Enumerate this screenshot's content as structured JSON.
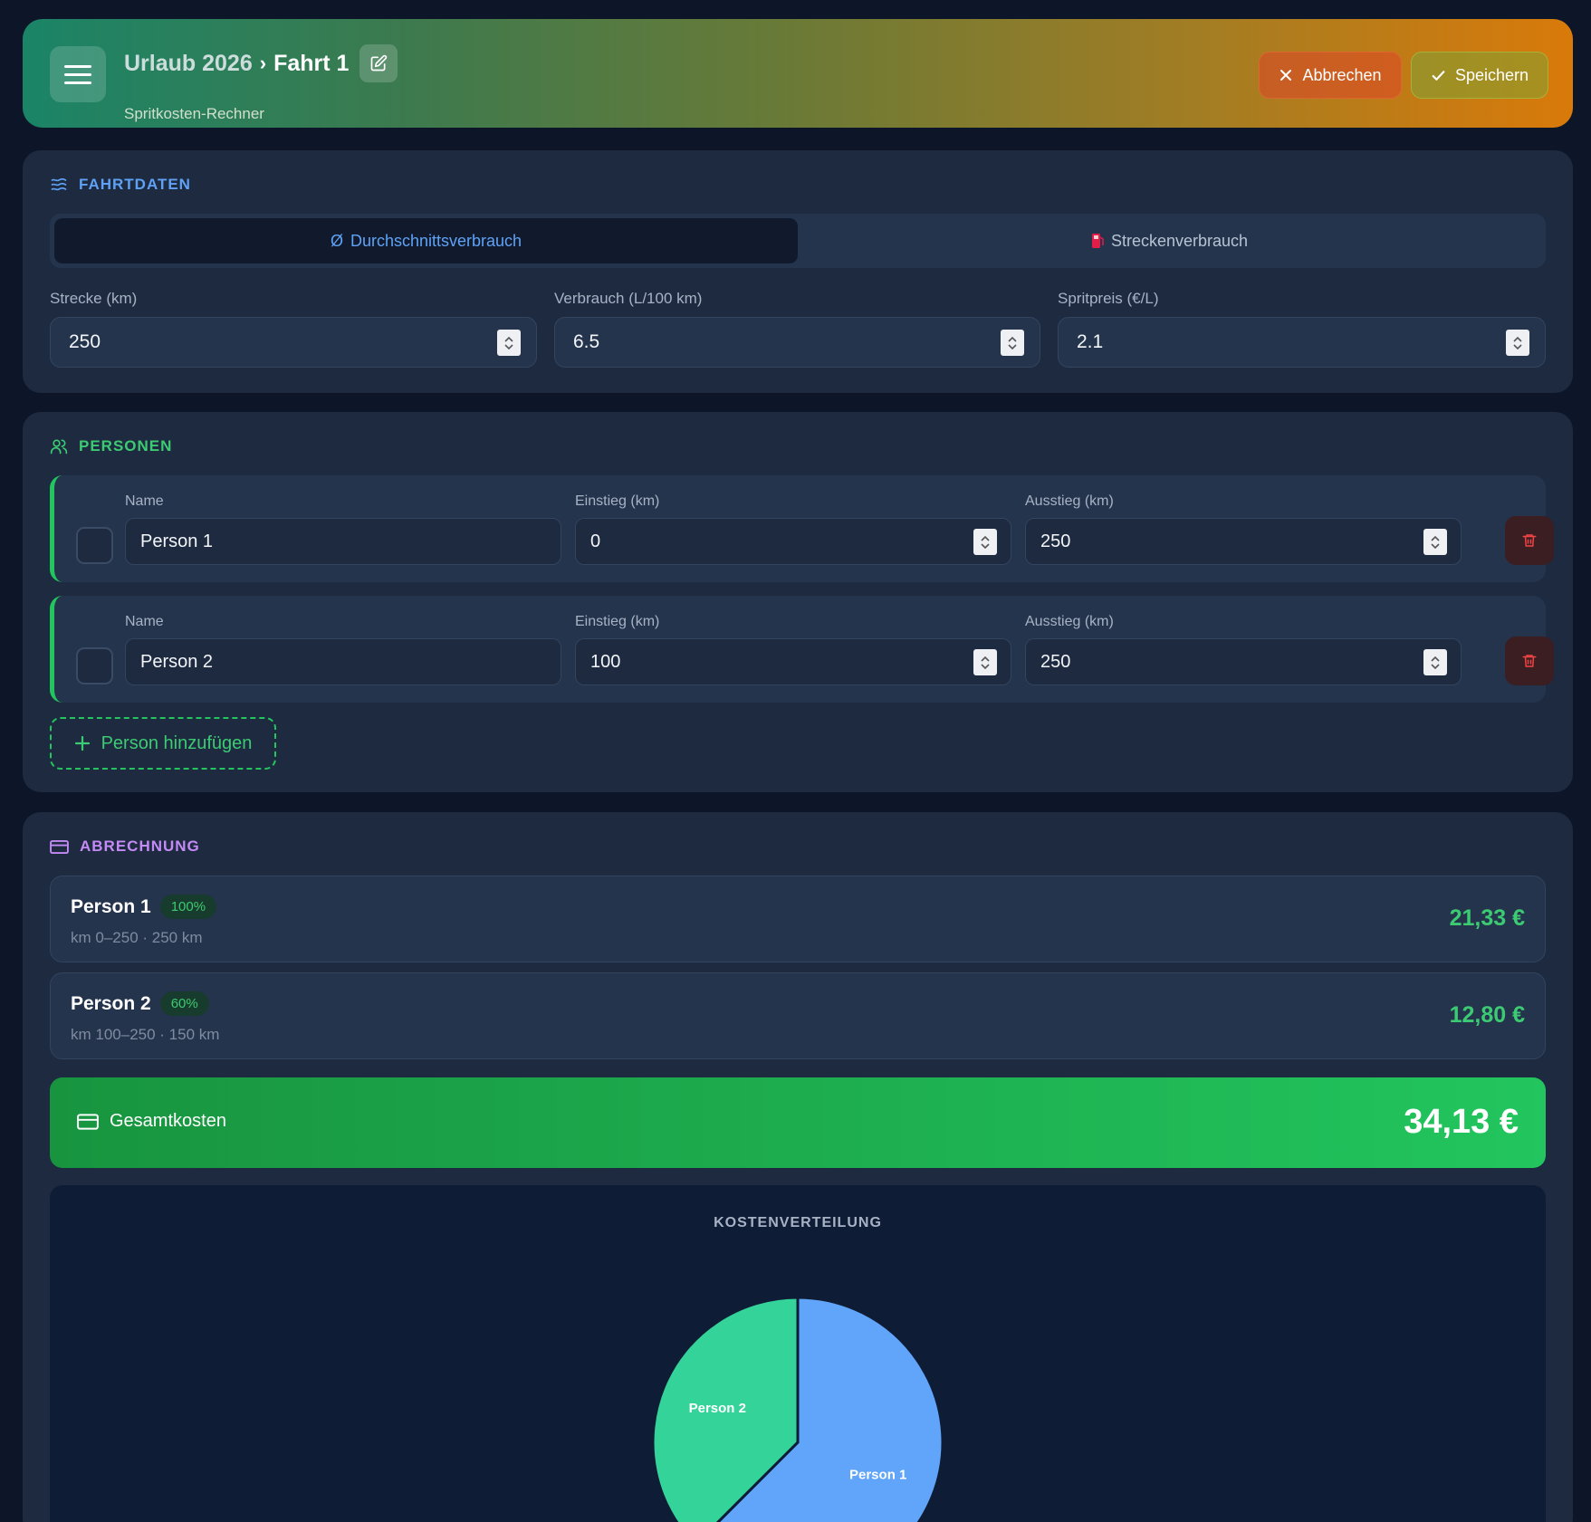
{
  "header": {
    "trip": "Urlaub 2026",
    "separator": "›",
    "ride": "Fahrt 1",
    "subtitle": "Spritkosten-Rechner",
    "cancel_label": "Abbrechen",
    "save_label": "Speichern"
  },
  "fahrtdaten": {
    "title": "FAHRTDATEN",
    "tabs": [
      {
        "icon": "Ø",
        "label": "Durchschnittsverbrauch",
        "active": true
      },
      {
        "icon": "fuel-pump",
        "label": "Streckenverbrauch",
        "active": false
      }
    ],
    "fields": [
      {
        "label": "Strecke (km)",
        "value": "250"
      },
      {
        "label": "Verbrauch (L/100 km)",
        "value": "6.5"
      },
      {
        "label": "Spritpreis (€/L)",
        "value": "2.1"
      }
    ]
  },
  "personen": {
    "title": "PERSONEN",
    "col_name": "Name",
    "col_start": "Einstieg (km)",
    "col_end": "Ausstieg (km)",
    "rows": [
      {
        "name": "Person 1",
        "start": "0",
        "end": "250"
      },
      {
        "name": "Person 2",
        "start": "100",
        "end": "250"
      }
    ],
    "add_label": "Person hinzufügen"
  },
  "abrechnung": {
    "title": "ABRECHNUNG",
    "rows": [
      {
        "name": "Person 1",
        "badge": "100%",
        "detail": "km 0–250 · 250 km",
        "amount": "21,33 €"
      },
      {
        "name": "Person 2",
        "badge": "60%",
        "detail": "km 100–250 · 150 km",
        "amount": "12,80 €"
      }
    ],
    "total_label": "Gesamtkosten",
    "total_amount": "34,13 €",
    "chart_title": "KOSTENVERTEILUNG"
  },
  "colors": {
    "accent_blue": "#5fa2f5",
    "accent_green": "#22c55e",
    "accent_purple": "#c48af5",
    "slice_person1": "#60a5fa",
    "slice_person2": "#34d399"
  },
  "chart_data": {
    "type": "pie",
    "title": "KOSTENVERTEILUNG",
    "categories": [
      "Person 1",
      "Person 2"
    ],
    "values": [
      21.33,
      12.8
    ],
    "colors": [
      "#60a5fa",
      "#34d399"
    ]
  }
}
